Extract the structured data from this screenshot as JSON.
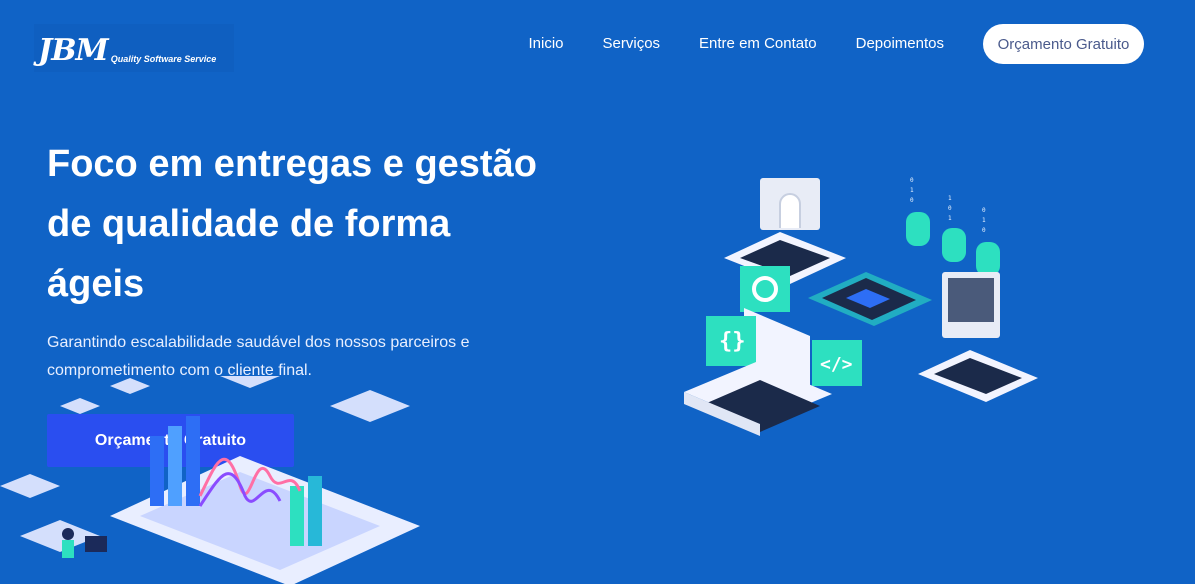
{
  "brand": {
    "name": "JBM",
    "tagline": "Quality Software Service"
  },
  "nav": {
    "items": [
      {
        "label": "Inicio"
      },
      {
        "label": "Serviços"
      },
      {
        "label": "Entre em Contato"
      },
      {
        "label": "Depoimentos"
      }
    ],
    "cta_label": "Orçamento Gratuito"
  },
  "hero": {
    "title": "Foco em entregas e gestão de qualidade de forma ágeis",
    "subtitle": "Garantindo escalabilidade saudável dos nossos parceiros e comprometimento com o cliente final.",
    "cta_label": "Orçamento Gratuito"
  },
  "colors": {
    "background": "#1063c6",
    "cta": "#2a4ef0",
    "accent": "#2de0c0"
  },
  "icons": [
    "curly-braces-icon",
    "code-tag-icon",
    "gear-icon",
    "cpu-chip-icon",
    "database-icon"
  ]
}
